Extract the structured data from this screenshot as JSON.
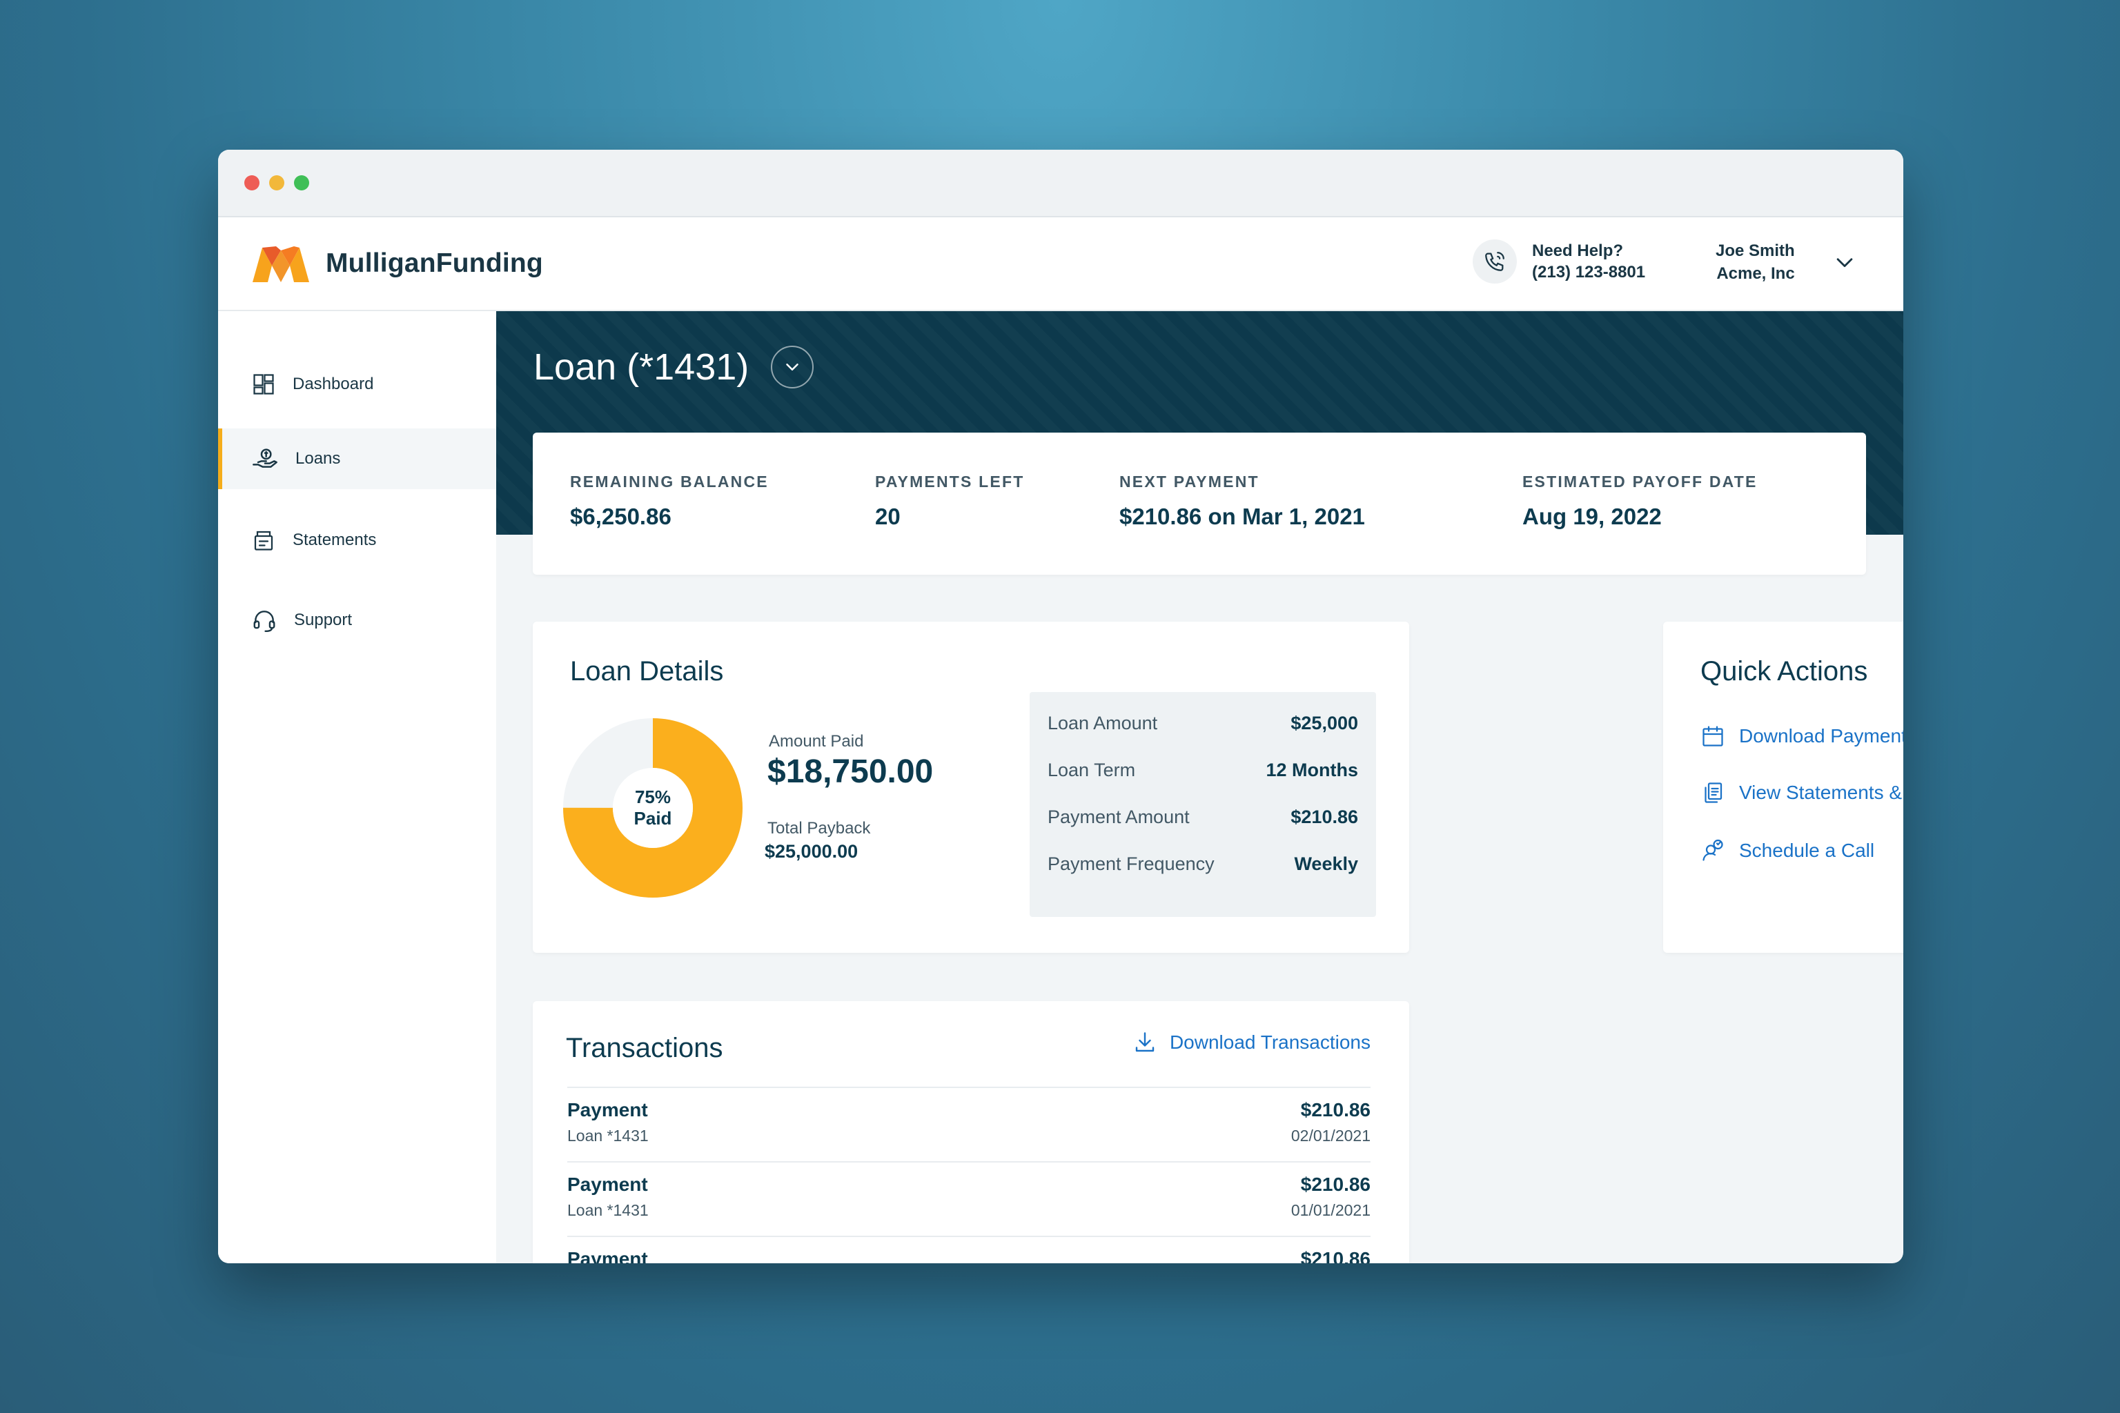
{
  "window": {
    "controls": [
      "close",
      "minimize",
      "maximize"
    ]
  },
  "header": {
    "brand_name": "MulliganFunding",
    "help_title": "Need Help?",
    "help_phone": "(213) 123-8801",
    "user_name": "Joe Smith",
    "user_company": "Acme, Inc"
  },
  "sidebar": {
    "items": [
      {
        "label": "Dashboard",
        "icon": "dashboard-icon",
        "active": false
      },
      {
        "label": "Loans",
        "icon": "loan-money-icon",
        "active": true
      },
      {
        "label": "Statements",
        "icon": "statements-icon",
        "active": false
      },
      {
        "label": "Support",
        "icon": "headset-icon",
        "active": false
      }
    ]
  },
  "loan": {
    "title": "Loan (*1431)",
    "summary": [
      {
        "label": "REMAINING BALANCE",
        "value": "$6,250.86"
      },
      {
        "label": "PAYMENTS LEFT",
        "value": "20"
      },
      {
        "label": "NEXT PAYMENT",
        "value": "$210.86 on Mar 1, 2021"
      },
      {
        "label": "ESTIMATED PAYOFF DATE",
        "value": "Aug 19, 2022"
      }
    ]
  },
  "loan_details": {
    "title": "Loan Details",
    "percent_paid": 75,
    "donut_percent_text": "75%",
    "donut_paid_text": "Paid",
    "amount_paid_label": "Amount Paid",
    "amount_paid_value": "$18,750.00",
    "total_payback_label": "Total Payback",
    "total_payback_value": "$25,000.00",
    "rows": [
      {
        "key": "Loan Amount",
        "value": "$25,000"
      },
      {
        "key": "Loan Term",
        "value": "12 Months"
      },
      {
        "key": "Payment Amount",
        "value": "$210.86"
      },
      {
        "key": "Payment Frequency",
        "value": "Weekly"
      }
    ]
  },
  "quick_actions": {
    "title": "Quick Actions",
    "items": [
      {
        "label": "Download Payment Schedule",
        "icon": "calendar-icon"
      },
      {
        "label": "View Statements & Forms",
        "icon": "documents-icon"
      },
      {
        "label": "Schedule a Call",
        "icon": "call-person-icon"
      }
    ]
  },
  "transactions": {
    "title": "Transactions",
    "download_label": "Download Transactions",
    "rows": [
      {
        "name": "Payment",
        "sub": "Loan *1431",
        "amount": "$210.86",
        "date": "02/01/2021"
      },
      {
        "name": "Payment",
        "sub": "Loan *1431",
        "amount": "$210.86",
        "date": "01/01/2021"
      },
      {
        "name": "Payment",
        "sub": "",
        "amount": "$210.86",
        "date": ""
      }
    ]
  },
  "colors": {
    "accent_orange": "#f5ad1b",
    "banner_navy": "#0d3a4d",
    "link_blue": "#1a72c7",
    "text_dark": "#0d3b4f"
  }
}
